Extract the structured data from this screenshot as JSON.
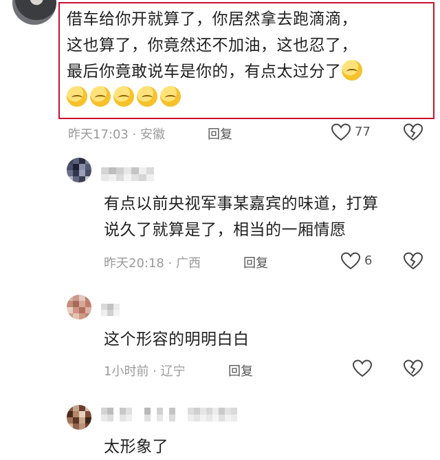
{
  "comments": [
    {
      "text_lines": [
        "借车给你开就算了，你居然拿去跑滴滴，",
        "这也算了，你竟然还不加油，这也忍了，",
        "最后你竟敢说车是你的，有点太过分了"
      ],
      "emoji_count_inline": 1,
      "emoji_count_line": 5,
      "emoji_name": "tired-face-emoji",
      "time_location": "昨天17:03 · 安徽",
      "reply_label": "回复",
      "likes": "77"
    },
    {
      "text_lines": [
        "有点以前央视军事某嘉宾的味道，打算",
        "说久了就算是了，相当的一厢情愿"
      ],
      "time_location": "昨天20:18 · 广西",
      "reply_label": "回复",
      "likes": "6"
    },
    {
      "text_lines": [
        "这个形容的明明白白"
      ],
      "time_location": "1小时前 · 辽宁",
      "reply_label": "回复",
      "likes": ""
    },
    {
      "text_lines": [
        "太形象了"
      ],
      "partial": true
    }
  ],
  "colors": {
    "highlight_border": "#c8102e",
    "meta_text": "#9a9a9a"
  },
  "icons": {
    "like": "heart-outline-icon",
    "dislike": "broken-heart-icon"
  }
}
